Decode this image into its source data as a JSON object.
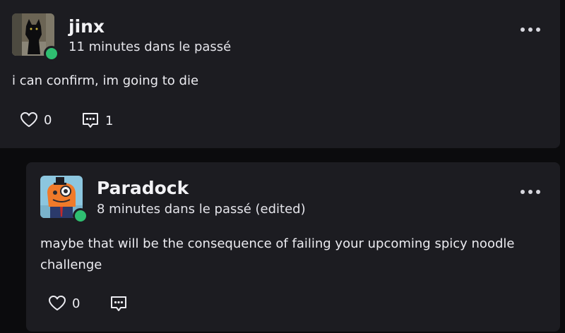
{
  "posts": [
    {
      "author": "jinx",
      "time": "11 minutes dans le passé",
      "text": "i can confirm, im going to die",
      "likes": "0",
      "comments": "1",
      "avatar_icon": "black-cat-photo",
      "status_color": "#2fbf71"
    },
    {
      "author": "Paradock",
      "time": "8 minutes dans le passé (edited)",
      "text": "maybe that will be the consequence of failing your upcoming spicy noodle challenge",
      "likes": "0",
      "comments": "",
      "avatar_icon": "orange-monocle-character",
      "status_color": "#2fbf71"
    }
  ]
}
